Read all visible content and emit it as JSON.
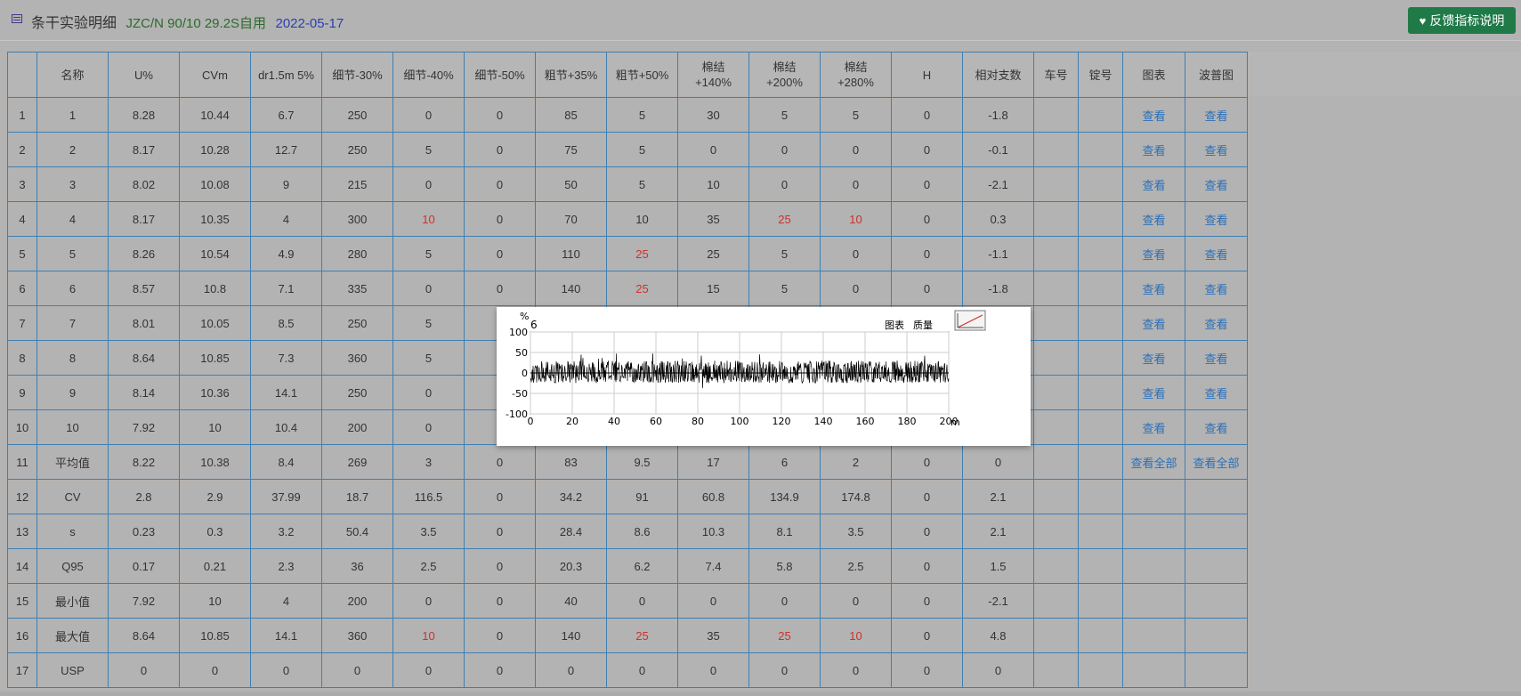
{
  "header": {
    "title": "条干实验明细",
    "spec": "JZC/N 90/10 29.2S自用",
    "date": "2022-05-17",
    "feedback_label": "反馈指标说明",
    "icons": {
      "title": "list-icon",
      "feedback": "heart-icon"
    }
  },
  "table": {
    "columns": [
      "",
      "名称",
      "U%",
      "CVm",
      "dr1.5m 5%",
      "细节-30%",
      "细节-40%",
      "细节-50%",
      "粗节+35%",
      "粗节+50%",
      "棉结 +140%",
      "棉结 +200%",
      "棉结 +280%",
      "H",
      "相对支数",
      "车号",
      "锭号",
      "图表",
      "波普图"
    ],
    "rows": [
      {
        "idx": "1",
        "name": "1",
        "u": "8.28",
        "cvm": "10.44",
        "dr": "6.7",
        "t30": "250",
        "t40": "0",
        "t50": "0",
        "k35": "85",
        "k50": "5",
        "n140": "30",
        "n200": "5",
        "n280": "5",
        "h": "0",
        "rel": "-1.8",
        "car": "",
        "spindle": "",
        "chart": "查看",
        "wave": "查看"
      },
      {
        "idx": "2",
        "name": "2",
        "u": "8.17",
        "cvm": "10.28",
        "dr": "12.7",
        "t30": "250",
        "t40": "5",
        "t50": "0",
        "k35": "75",
        "k50": "5",
        "n140": "0",
        "n200": "0",
        "n280": "0",
        "h": "0",
        "rel": "-0.1",
        "car": "",
        "spindle": "",
        "chart": "查看",
        "wave": "查看"
      },
      {
        "idx": "3",
        "name": "3",
        "u": "8.02",
        "cvm": "10.08",
        "dr": "9",
        "t30": "215",
        "t40": "0",
        "t50": "0",
        "k35": "50",
        "k50": "5",
        "n140": "10",
        "n200": "0",
        "n280": "0",
        "h": "0",
        "rel": "-2.1",
        "car": "",
        "spindle": "",
        "chart": "查看",
        "wave": "查看"
      },
      {
        "idx": "4",
        "name": "4",
        "u": "8.17",
        "cvm": "10.35",
        "dr": "4",
        "t30": "300",
        "t40": "10",
        "t50": "0",
        "k35": "70",
        "k50": "10",
        "n140": "35",
        "n200": "25",
        "n280": "10",
        "h": "0",
        "rel": "0.3",
        "car": "",
        "spindle": "",
        "chart": "查看",
        "wave": "查看"
      },
      {
        "idx": "5",
        "name": "5",
        "u": "8.26",
        "cvm": "10.54",
        "dr": "4.9",
        "t30": "280",
        "t40": "5",
        "t50": "0",
        "k35": "110",
        "k50": "25",
        "n140": "25",
        "n200": "5",
        "n280": "0",
        "h": "0",
        "rel": "-1.1",
        "car": "",
        "spindle": "",
        "chart": "查看",
        "wave": "查看"
      },
      {
        "idx": "6",
        "name": "6",
        "u": "8.57",
        "cvm": "10.8",
        "dr": "7.1",
        "t30": "335",
        "t40": "0",
        "t50": "0",
        "k35": "140",
        "k50": "25",
        "n140": "15",
        "n200": "5",
        "n280": "0",
        "h": "0",
        "rel": "-1.8",
        "car": "",
        "spindle": "",
        "chart": "查看",
        "wave": "查看"
      },
      {
        "idx": "7",
        "name": "7",
        "u": "8.01",
        "cvm": "10.05",
        "dr": "8.5",
        "t30": "250",
        "t40": "5",
        "t50": "",
        "k35": "",
        "k50": "",
        "n140": "",
        "n200": "",
        "n280": "",
        "h": "",
        "rel": "",
        "car": "",
        "spindle": "",
        "chart": "查看",
        "wave": "查看"
      },
      {
        "idx": "8",
        "name": "8",
        "u": "8.64",
        "cvm": "10.85",
        "dr": "7.3",
        "t30": "360",
        "t40": "5",
        "t50": "",
        "k35": "",
        "k50": "",
        "n140": "",
        "n200": "",
        "n280": "",
        "h": "",
        "rel": "",
        "car": "",
        "spindle": "",
        "chart": "查看",
        "wave": "查看"
      },
      {
        "idx": "9",
        "name": "9",
        "u": "8.14",
        "cvm": "10.36",
        "dr": "14.1",
        "t30": "250",
        "t40": "0",
        "t50": "",
        "k35": "",
        "k50": "",
        "n140": "",
        "n200": "",
        "n280": "",
        "h": "",
        "rel": "",
        "car": "",
        "spindle": "",
        "chart": "查看",
        "wave": "查看"
      },
      {
        "idx": "10",
        "name": "10",
        "u": "7.92",
        "cvm": "10",
        "dr": "10.4",
        "t30": "200",
        "t40": "0",
        "t50": "",
        "k35": "",
        "k50": "",
        "n140": "",
        "n200": "",
        "n280": "",
        "h": "",
        "rel": "",
        "car": "",
        "spindle": "",
        "chart": "查看",
        "wave": "查看"
      },
      {
        "idx": "11",
        "name": "平均值",
        "u": "8.22",
        "cvm": "10.38",
        "dr": "8.4",
        "t30": "269",
        "t40": "3",
        "t50": "0",
        "k35": "83",
        "k50": "9.5",
        "n140": "17",
        "n200": "6",
        "n280": "2",
        "h": "0",
        "rel": "0",
        "car": "",
        "spindle": "",
        "chart": "查看全部",
        "wave": "查看全部"
      },
      {
        "idx": "12",
        "name": "CV",
        "u": "2.8",
        "cvm": "2.9",
        "dr": "37.99",
        "t30": "18.7",
        "t40": "116.5",
        "t50": "0",
        "k35": "34.2",
        "k50": "91",
        "n140": "60.8",
        "n200": "134.9",
        "n280": "174.8",
        "h": "0",
        "rel": "2.1",
        "car": "",
        "spindle": "",
        "chart": "",
        "wave": ""
      },
      {
        "idx": "13",
        "name": "s",
        "u": "0.23",
        "cvm": "0.3",
        "dr": "3.2",
        "t30": "50.4",
        "t40": "3.5",
        "t50": "0",
        "k35": "28.4",
        "k50": "8.6",
        "n140": "10.3",
        "n200": "8.1",
        "n280": "3.5",
        "h": "0",
        "rel": "2.1",
        "car": "",
        "spindle": "",
        "chart": "",
        "wave": ""
      },
      {
        "idx": "14",
        "name": "Q95",
        "u": "0.17",
        "cvm": "0.21",
        "dr": "2.3",
        "t30": "36",
        "t40": "2.5",
        "t50": "0",
        "k35": "20.3",
        "k50": "6.2",
        "n140": "7.4",
        "n200": "5.8",
        "n280": "2.5",
        "h": "0",
        "rel": "1.5",
        "car": "",
        "spindle": "",
        "chart": "",
        "wave": ""
      },
      {
        "idx": "15",
        "name": "最小值",
        "u": "7.92",
        "cvm": "10",
        "dr": "4",
        "t30": "200",
        "t40": "0",
        "t50": "0",
        "k35": "40",
        "k50": "0",
        "n140": "0",
        "n200": "0",
        "n280": "0",
        "h": "0",
        "rel": "-2.1",
        "car": "",
        "spindle": "",
        "chart": "",
        "wave": ""
      },
      {
        "idx": "16",
        "name": "最大值",
        "u": "8.64",
        "cvm": "10.85",
        "dr": "14.1",
        "t30": "360",
        "t40": "10",
        "t50": "0",
        "k35": "140",
        "k50": "25",
        "n140": "35",
        "n200": "25",
        "n280": "10",
        "h": "0",
        "rel": "4.8",
        "car": "",
        "spindle": "",
        "chart": "",
        "wave": ""
      },
      {
        "idx": "17",
        "name": "USP",
        "u": "0",
        "cvm": "0",
        "dr": "0",
        "t30": "0",
        "t40": "0",
        "t50": "0",
        "k35": "0",
        "k50": "0",
        "n140": "0",
        "n200": "0",
        "n280": "0",
        "h": "0",
        "rel": "0",
        "car": "",
        "spindle": "",
        "chart": "",
        "wave": ""
      }
    ],
    "red_cells": [
      {
        "row": 3,
        "col": "t40"
      },
      {
        "row": 3,
        "col": "n200"
      },
      {
        "row": 3,
        "col": "n280"
      },
      {
        "row": 4,
        "col": "k50"
      },
      {
        "row": 5,
        "col": "k50"
      },
      {
        "row": 15,
        "col": "t40"
      },
      {
        "row": 15,
        "col": "k50"
      },
      {
        "row": 15,
        "col": "n200"
      },
      {
        "row": 15,
        "col": "n280"
      }
    ]
  },
  "popup": {
    "sample_label": "6",
    "y_unit": "%",
    "x_unit": "m",
    "tab_chart": "图表",
    "tab_quality": "质量",
    "y_ticks": [
      "100",
      "50",
      "0",
      "-50",
      "-100"
    ],
    "x_ticks": [
      "0",
      "20",
      "40",
      "60",
      "80",
      "100",
      "120",
      "140",
      "160",
      "180",
      "200"
    ],
    "chart_data": {
      "type": "line",
      "title": "",
      "xlabel": "m",
      "ylabel": "%",
      "xlim": [
        0,
        200
      ],
      "ylim": [
        -100,
        100
      ],
      "series": [
        {
          "amplitude_range": [
            -25,
            30
          ]
        }
      ]
    }
  }
}
